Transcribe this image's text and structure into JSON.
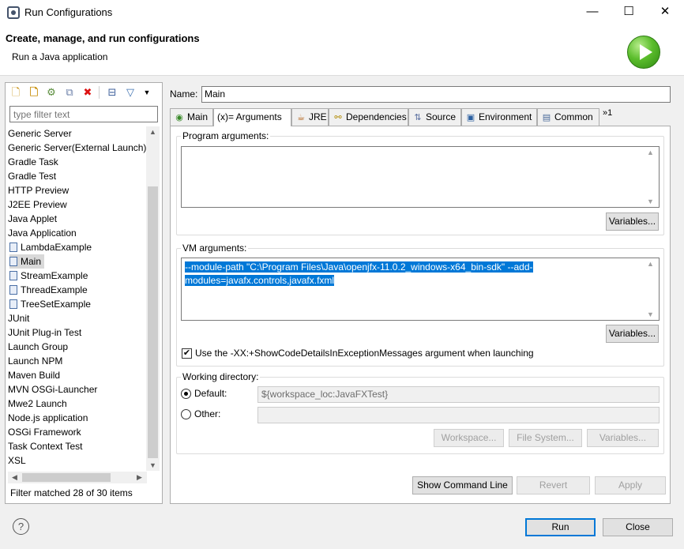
{
  "window": {
    "title": "Run Configurations",
    "icon": "eclipse-run-config-icon",
    "minimize": "—",
    "maximize": "☐",
    "close": "✕"
  },
  "header": {
    "title": "Create, manage, and run configurations",
    "subtitle": "Run a Java application",
    "logo_icon": "run-play-icon"
  },
  "toolbar": {
    "new": "new-config-icon",
    "new_proto": "new-prototype-icon",
    "export": "export-icon",
    "duplicate": "duplicate-icon",
    "delete": "delete-icon",
    "collapse": "collapse-all-icon",
    "filter": "filter-icon",
    "menu": "view-menu-icon"
  },
  "filter": {
    "placeholder": "type filter text"
  },
  "tree": {
    "items": [
      {
        "label": "Generic Server",
        "child": false
      },
      {
        "label": "Generic Server(External Launch)",
        "child": false
      },
      {
        "label": "Gradle Task",
        "child": false
      },
      {
        "label": "Gradle Test",
        "child": false
      },
      {
        "label": "HTTP Preview",
        "child": false
      },
      {
        "label": "J2EE Preview",
        "child": false
      },
      {
        "label": "Java Applet",
        "child": false
      },
      {
        "label": "Java Application",
        "child": false
      },
      {
        "label": "LambdaExample",
        "child": true
      },
      {
        "label": "Main",
        "child": true,
        "selected": true
      },
      {
        "label": "StreamExample",
        "child": true
      },
      {
        "label": "ThreadExample",
        "child": true
      },
      {
        "label": "TreeSetExample",
        "child": true
      },
      {
        "label": "JUnit",
        "child": false
      },
      {
        "label": "JUnit Plug-in Test",
        "child": false
      },
      {
        "label": "Launch Group",
        "child": false
      },
      {
        "label": "Launch NPM",
        "child": false
      },
      {
        "label": "Maven Build",
        "child": false
      },
      {
        "label": "MVN OSGi-Launcher",
        "child": false
      },
      {
        "label": "Mwe2 Launch",
        "child": false
      },
      {
        "label": "Node.js application",
        "child": false
      },
      {
        "label": "OSGi Framework",
        "child": false
      },
      {
        "label": "Task Context Test",
        "child": false
      },
      {
        "label": "XSL",
        "child": false
      }
    ],
    "status": "Filter matched 28 of 30 items"
  },
  "form": {
    "name_label": "Name:",
    "name_value": "Main"
  },
  "tabs": [
    {
      "label": "Main",
      "icon": "main-tab-icon"
    },
    {
      "label": "Arguments",
      "icon": "arguments-tab-icon",
      "prefix": "(x)="
    },
    {
      "label": "JRE",
      "icon": "jre-tab-icon"
    },
    {
      "label": "Dependencies",
      "icon": "dependencies-tab-icon"
    },
    {
      "label": "Source",
      "icon": "source-tab-icon"
    },
    {
      "label": "Environment",
      "icon": "environment-tab-icon"
    },
    {
      "label": "Common",
      "icon": "common-tab-icon"
    },
    {
      "label": "»1",
      "icon": "more-tabs-icon"
    }
  ],
  "arguments": {
    "program_label": "Program arguments:",
    "program_value": "",
    "variables_label": "Variables...",
    "vm_label": "VM arguments:",
    "vm_line1": "--module-path \"C:\\Program Files\\Java\\openjfx-11.0.2_windows-x64_bin-sdk\" --add-",
    "vm_line2": "modules=javafx.controls,javafx.fxml",
    "vm_variables_label": "Variables...",
    "showcode_label": "Use the -XX:+ShowCodeDetailsInExceptionMessages argument when launching",
    "showcode_checked": true,
    "workdir_label": "Working directory:",
    "default_label": "Default:",
    "default_value": "${workspace_loc:JavaFXTest}",
    "other_label": "Other:",
    "other_value": "",
    "workspace_btn": "Workspace...",
    "filesystem_btn": "File System...",
    "wd_variables_btn": "Variables..."
  },
  "actions": {
    "show_cmd": "Show Command Line",
    "revert": "Revert",
    "apply": "Apply",
    "run": "Run",
    "close": "Close",
    "help": "?"
  }
}
